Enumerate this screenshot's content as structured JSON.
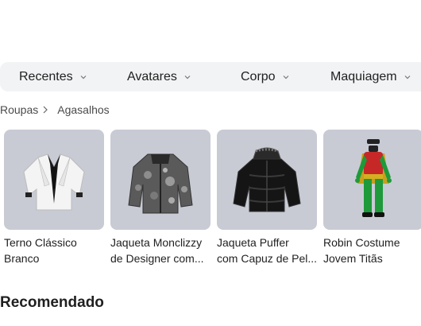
{
  "tabs": [
    {
      "label": "Recentes"
    },
    {
      "label": "Avatares"
    },
    {
      "label": "Corpo"
    },
    {
      "label": "Maquiagem"
    }
  ],
  "breadcrumb": {
    "parent": "Roupas",
    "current": "Agasalhos"
  },
  "items": [
    {
      "line1": "Terno Clássico",
      "line2": "Branco"
    },
    {
      "line1": "Jaqueta Monclizzy",
      "line2": "de Designer com..."
    },
    {
      "line1": "Jaqueta Puffer",
      "line2": "com Capuz de Pel..."
    },
    {
      "line1": "Robin Costume",
      "line2": "Jovem Titãs"
    }
  ],
  "section": {
    "title": "Recomendado"
  },
  "colors": {
    "tabbar_bg": "#f2f3f5",
    "thumb_bg": "#c8cbd4",
    "text": "#1f1f1f"
  }
}
